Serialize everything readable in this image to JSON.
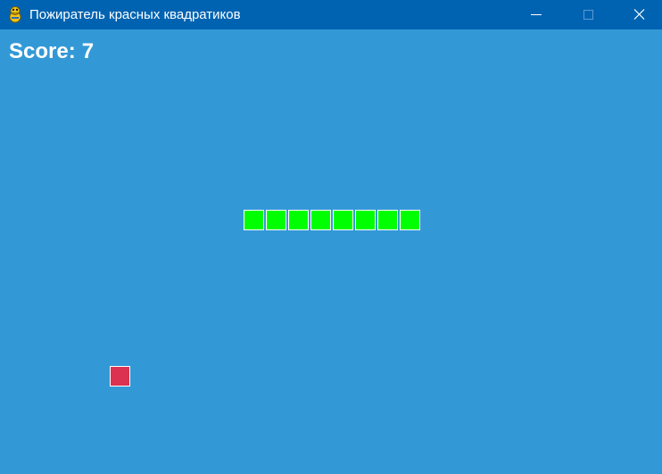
{
  "window": {
    "title": "Пожиратель красных квадратиков",
    "icon": "pygame-snake-icon",
    "controls": [
      "minimize-icon",
      "maximize-icon",
      "close-icon"
    ]
  },
  "hud": {
    "score_label": "Score:",
    "score_value": "7"
  },
  "game": {
    "snake_length": 8,
    "snake_direction": "horizontal",
    "food_count": 1
  },
  "colors": {
    "background": "#3399d6",
    "titlebar": "#0063b1",
    "snake": "#00ff00",
    "food": "#dc3150",
    "cell_border": "#ffffff",
    "text": "#ffffff"
  }
}
